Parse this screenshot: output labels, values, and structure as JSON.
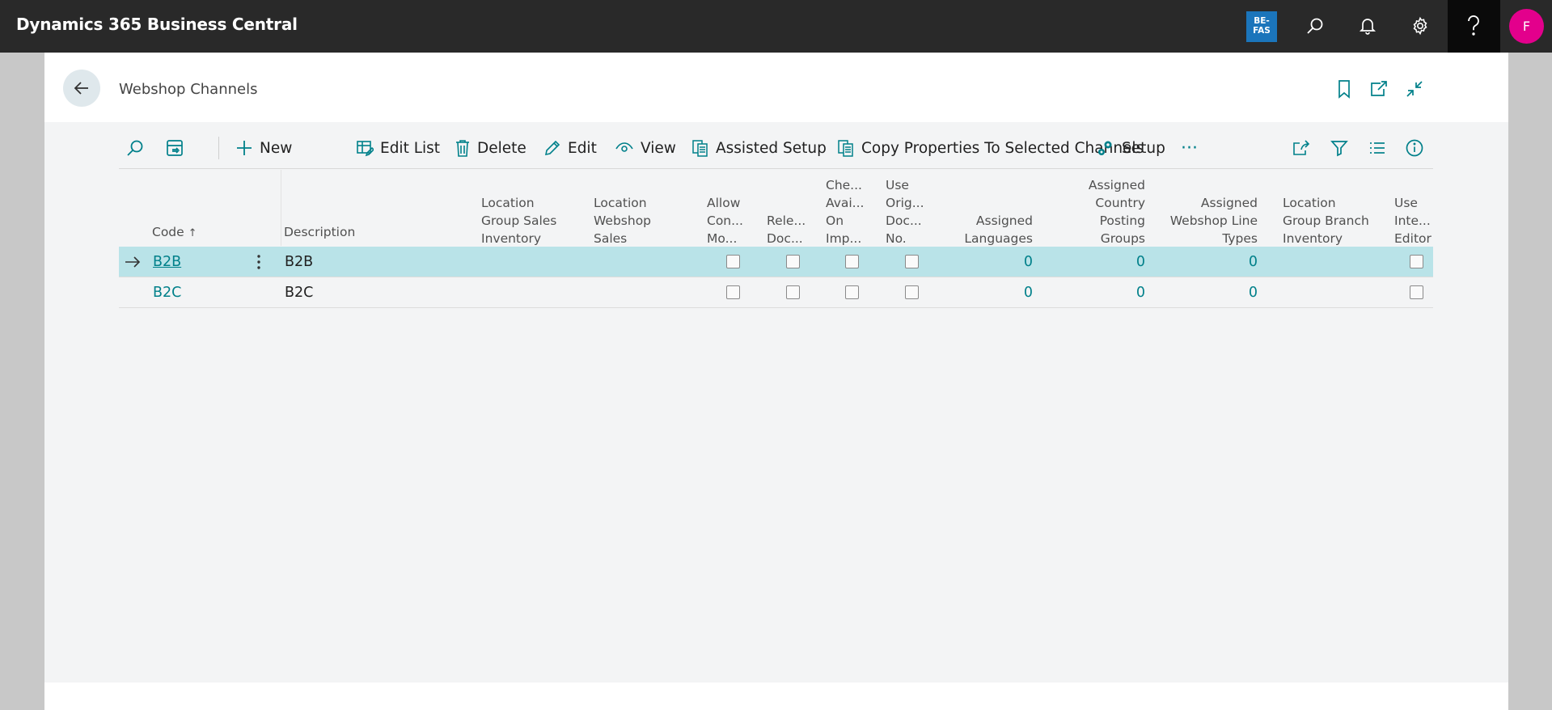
{
  "app": {
    "title": "Dynamics 365 Business Central",
    "company_badge": "BE-\nFAS",
    "avatar_initial": "F",
    "colors": {
      "topbar": "#292929",
      "accent": "#00808a",
      "avatar": "#e3008c",
      "badge": "#1b75bb",
      "selected_row": "#b9e3e8"
    }
  },
  "page": {
    "title": "Webshop Channels"
  },
  "actions": {
    "new": "New",
    "edit_list": "Edit List",
    "delete": "Delete",
    "edit": "Edit",
    "view": "View",
    "assisted_setup": "Assisted Setup",
    "copy_properties": "Copy Properties To Selected Channels",
    "setup": "Setup",
    "more": "···"
  },
  "columns": {
    "code": "Code",
    "sort_indicator": "↑",
    "description": "Description",
    "location_group_sales_inventory": [
      "Location",
      "Group Sales",
      "Inventory"
    ],
    "location_webshop_sales": [
      "Location",
      "Webshop",
      "Sales"
    ],
    "allow_con_mo": [
      "Allow",
      "Con...",
      "Mo..."
    ],
    "rele_doc": [
      "Rele...",
      "Doc..."
    ],
    "che_avai_on_imp": [
      "Che...",
      "Avai...",
      "On",
      "Imp..."
    ],
    "use_orig_doc_no": [
      "Use",
      "Orig...",
      "Doc...",
      "No."
    ],
    "assigned_languages": [
      "Assigned",
      "Languages"
    ],
    "assigned_country_posting_groups": [
      "Assigned",
      "Country",
      "Posting",
      "Groups"
    ],
    "assigned_webshop_line_types": [
      "Assigned",
      "Webshop Line",
      "Types"
    ],
    "location_group_branch_inventory": [
      "Location",
      "Group Branch",
      "Inventory"
    ],
    "use_inte_editor": [
      "Use",
      "Inte...",
      "Editor"
    ]
  },
  "rows": [
    {
      "code": "B2B",
      "description": "B2B",
      "assigned_languages": "0",
      "assigned_country_posting_groups": "0",
      "assigned_webshop_line_types": "0",
      "selected": true
    },
    {
      "code": "B2C",
      "description": "B2C",
      "assigned_languages": "0",
      "assigned_country_posting_groups": "0",
      "assigned_webshop_line_types": "0",
      "selected": false
    }
  ]
}
